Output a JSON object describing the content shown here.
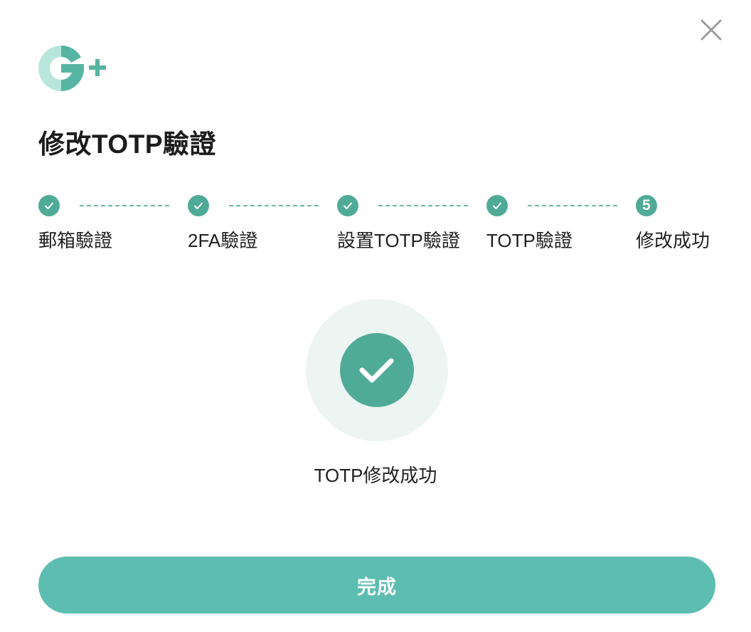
{
  "dialog": {
    "title": "修改TOTP驗證",
    "close_icon": "close-icon",
    "logo": {
      "text": "G+",
      "icon": "g-plus-logo"
    }
  },
  "colors": {
    "accent": "#4fab97",
    "button": "#5dbdb1",
    "halo": "#edf5f3",
    "logo_light": "#b9e6dc",
    "close_icon": "#9b9b9b"
  },
  "steps": [
    {
      "label": "郵箱驗證",
      "status": "completed",
      "icon": "check-icon"
    },
    {
      "label": "2FA驗證",
      "status": "completed",
      "icon": "check-icon"
    },
    {
      "label": "設置TOTP驗證",
      "status": "completed",
      "icon": "check-icon"
    },
    {
      "label": "TOTP驗證",
      "status": "completed",
      "icon": "check-icon"
    },
    {
      "label": "修改成功",
      "status": "current",
      "number": "5"
    }
  ],
  "result": {
    "icon": "success-check-icon",
    "message": "TOTP修改成功"
  },
  "actions": {
    "done_label": "完成"
  }
}
